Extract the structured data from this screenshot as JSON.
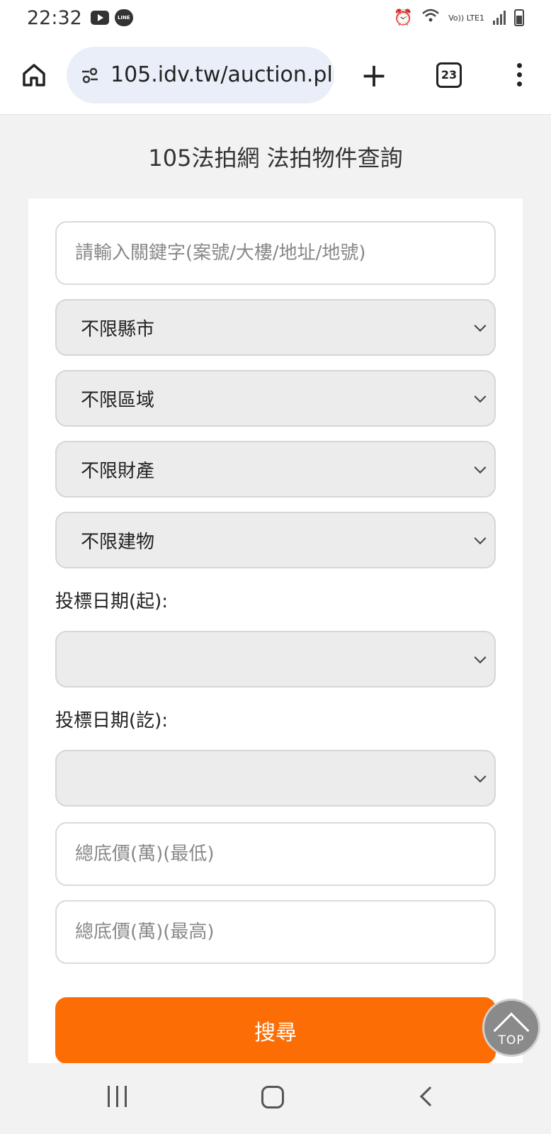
{
  "status_bar": {
    "time": "22:32",
    "app_icons": [
      "youtube-icon",
      "line-icon"
    ],
    "line_text": "LINE",
    "network_label": "Vo)) LTE1",
    "icons": [
      "alarm-icon",
      "wifi-icon",
      "signal-icon",
      "battery-icon"
    ]
  },
  "browser": {
    "url": "105.idv.tw/auction.pl",
    "tab_count": "23",
    "plus": "+"
  },
  "page": {
    "title": "105法拍網 法拍物件查詢"
  },
  "form": {
    "keyword_placeholder": "請輸入關鍵字(案號/大樓/地址/地號)",
    "keyword_value": "",
    "city_select": "不限縣市",
    "area_select": "不限區域",
    "property_select": "不限財產",
    "building_select": "不限建物",
    "date_start_label": "投標日期(起):",
    "date_start_value": "",
    "date_end_label": "投標日期(訖):",
    "date_end_value": "",
    "price_min_placeholder": "總底價(萬)(最低)",
    "price_max_placeholder": "總底價(萬)(最高)",
    "search_label": "搜尋"
  },
  "top_button": {
    "label": "TOP"
  },
  "colors": {
    "accent": "#fd6d05",
    "select_bg": "#ececec",
    "page_bg": "#f2f2f2",
    "url_pill_bg": "#e9eef8"
  }
}
